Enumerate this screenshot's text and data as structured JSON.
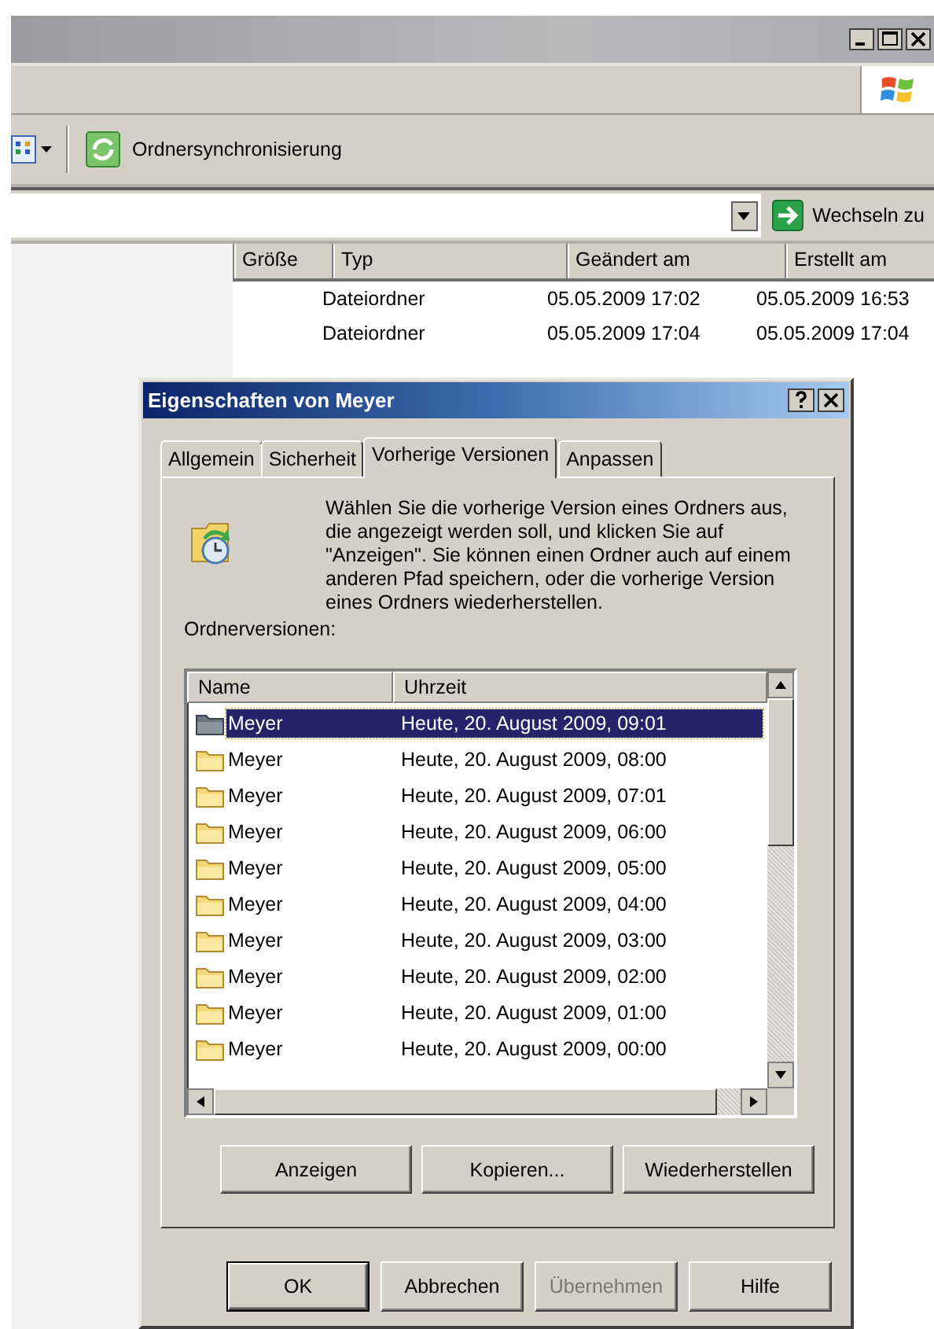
{
  "explorer": {
    "toolbar": {
      "sync_button": "Ordnersynchronisierung"
    },
    "address": {
      "go_button": "Wechseln zu"
    },
    "columns": [
      "Größe",
      "Typ",
      "Geändert am",
      "Erstellt am"
    ],
    "rows": [
      {
        "type": "Dateiordner",
        "modified": "05.05.2009 17:02",
        "created": "05.05.2009 16:53"
      },
      {
        "type": "Dateiordner",
        "modified": "05.05.2009 17:04",
        "created": "05.05.2009 17:04"
      }
    ]
  },
  "dialog": {
    "title": "Eigenschaften von Meyer",
    "tabs": [
      {
        "label": "Allgemein",
        "selected": false
      },
      {
        "label": "Sicherheit",
        "selected": false
      },
      {
        "label": "Vorherige Versionen",
        "selected": true
      },
      {
        "label": "Anpassen",
        "selected": false
      }
    ],
    "description": "Wählen Sie die vorherige Version eines Ordners aus, die angezeigt werden soll, und klicken Sie auf \"Anzeigen\". Sie können einen Ordner auch auf einem anderen Pfad speichern, oder die vorherige Version eines Ordners wiederherstellen.",
    "list_label": "Ordnerversionen:",
    "list": {
      "columns": [
        "Name",
        "Uhrzeit"
      ],
      "rows": [
        {
          "name": "Meyer",
          "time": "Heute, 20. August 2009, 09:01",
          "selected": true
        },
        {
          "name": "Meyer",
          "time": "Heute, 20. August 2009, 08:00",
          "selected": false
        },
        {
          "name": "Meyer",
          "time": "Heute, 20. August 2009, 07:01",
          "selected": false
        },
        {
          "name": "Meyer",
          "time": "Heute, 20. August 2009, 06:00",
          "selected": false
        },
        {
          "name": "Meyer",
          "time": "Heute, 20. August 2009, 05:00",
          "selected": false
        },
        {
          "name": "Meyer",
          "time": "Heute, 20. August 2009, 04:00",
          "selected": false
        },
        {
          "name": "Meyer",
          "time": "Heute, 20. August 2009, 03:00",
          "selected": false
        },
        {
          "name": "Meyer",
          "time": "Heute, 20. August 2009, 02:00",
          "selected": false
        },
        {
          "name": "Meyer",
          "time": "Heute, 20. August 2009, 01:00",
          "selected": false
        },
        {
          "name": "Meyer",
          "time": "Heute, 20. August 2009, 00:00",
          "selected": false
        }
      ]
    },
    "actions": [
      {
        "label": "Anzeigen"
      },
      {
        "label": "Kopieren..."
      },
      {
        "label": "Wiederherstellen"
      }
    ],
    "buttons": [
      {
        "label": "OK",
        "default": true,
        "disabled": false
      },
      {
        "label": "Abbrechen",
        "default": false,
        "disabled": false
      },
      {
        "label": "Übernehmen",
        "default": false,
        "disabled": true
      },
      {
        "label": "Hilfe",
        "default": false,
        "disabled": false
      }
    ]
  }
}
